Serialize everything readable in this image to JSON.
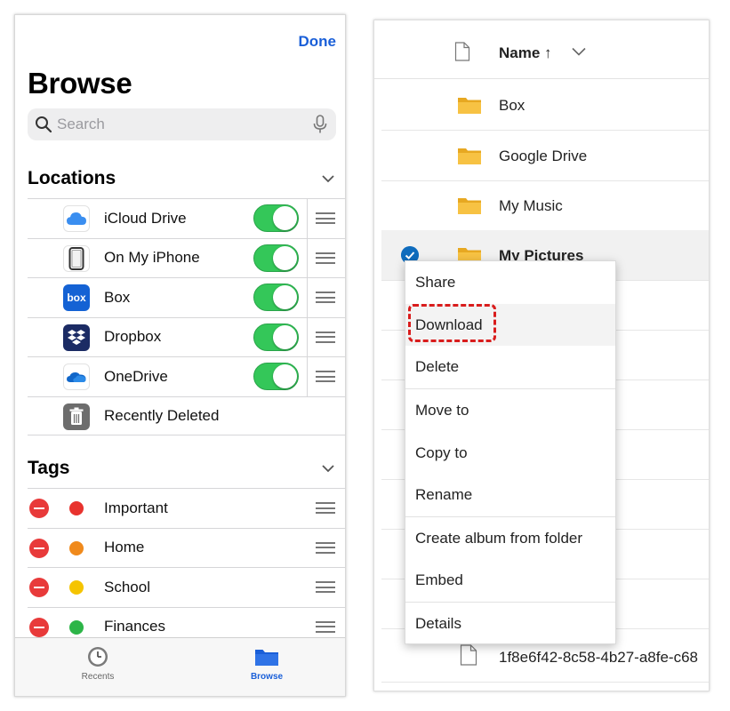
{
  "browse": {
    "done_label": "Done",
    "title": "Browse",
    "search_placeholder": "Search",
    "locations": {
      "title": "Locations",
      "items": [
        {
          "label": "iCloud Drive",
          "icon": "icloud-icon",
          "enabled": true
        },
        {
          "label": "On My iPhone",
          "icon": "iphone-icon",
          "enabled": true
        },
        {
          "label": "Box",
          "icon": "box-icon",
          "icon_text": "box",
          "enabled": true
        },
        {
          "label": "Dropbox",
          "icon": "dropbox-icon",
          "enabled": true
        },
        {
          "label": "OneDrive",
          "icon": "onedrive-icon",
          "enabled": true
        },
        {
          "label": "Recently Deleted",
          "icon": "trash-icon"
        }
      ]
    },
    "tags": {
      "title": "Tags",
      "items": [
        {
          "label": "Important",
          "color": "#e8332e"
        },
        {
          "label": "Home",
          "color": "#f08a1c"
        },
        {
          "label": "School",
          "color": "#f5c400"
        },
        {
          "label": "Finances",
          "color": "#2db548"
        }
      ]
    },
    "tabbar": {
      "recents_label": "Recents",
      "browse_label": "Browse"
    },
    "colors": {
      "accent": "#1a5fd8",
      "toggle_on": "#34c759"
    }
  },
  "onedrive": {
    "header": {
      "name_label": "Name ↑"
    },
    "files": [
      {
        "name": "Box",
        "type": "folder"
      },
      {
        "name": "Google Drive",
        "type": "folder"
      },
      {
        "name": "My Music",
        "type": "folder"
      },
      {
        "name": "My Pictures",
        "type": "folder",
        "selected": true
      },
      {
        "name": "1f8e6f42-8c58-4b27-a8fe-c68",
        "type": "file"
      }
    ],
    "context_menu": {
      "items": [
        "Share",
        "Download",
        "Delete",
        "Move to",
        "Copy to",
        "Rename",
        "Create album from folder",
        "Embed",
        "Details"
      ],
      "highlighted": "Download"
    },
    "colors": {
      "folder": "#f7c243",
      "check": "#0f6cbd",
      "highlight": "#d91c1c"
    }
  }
}
